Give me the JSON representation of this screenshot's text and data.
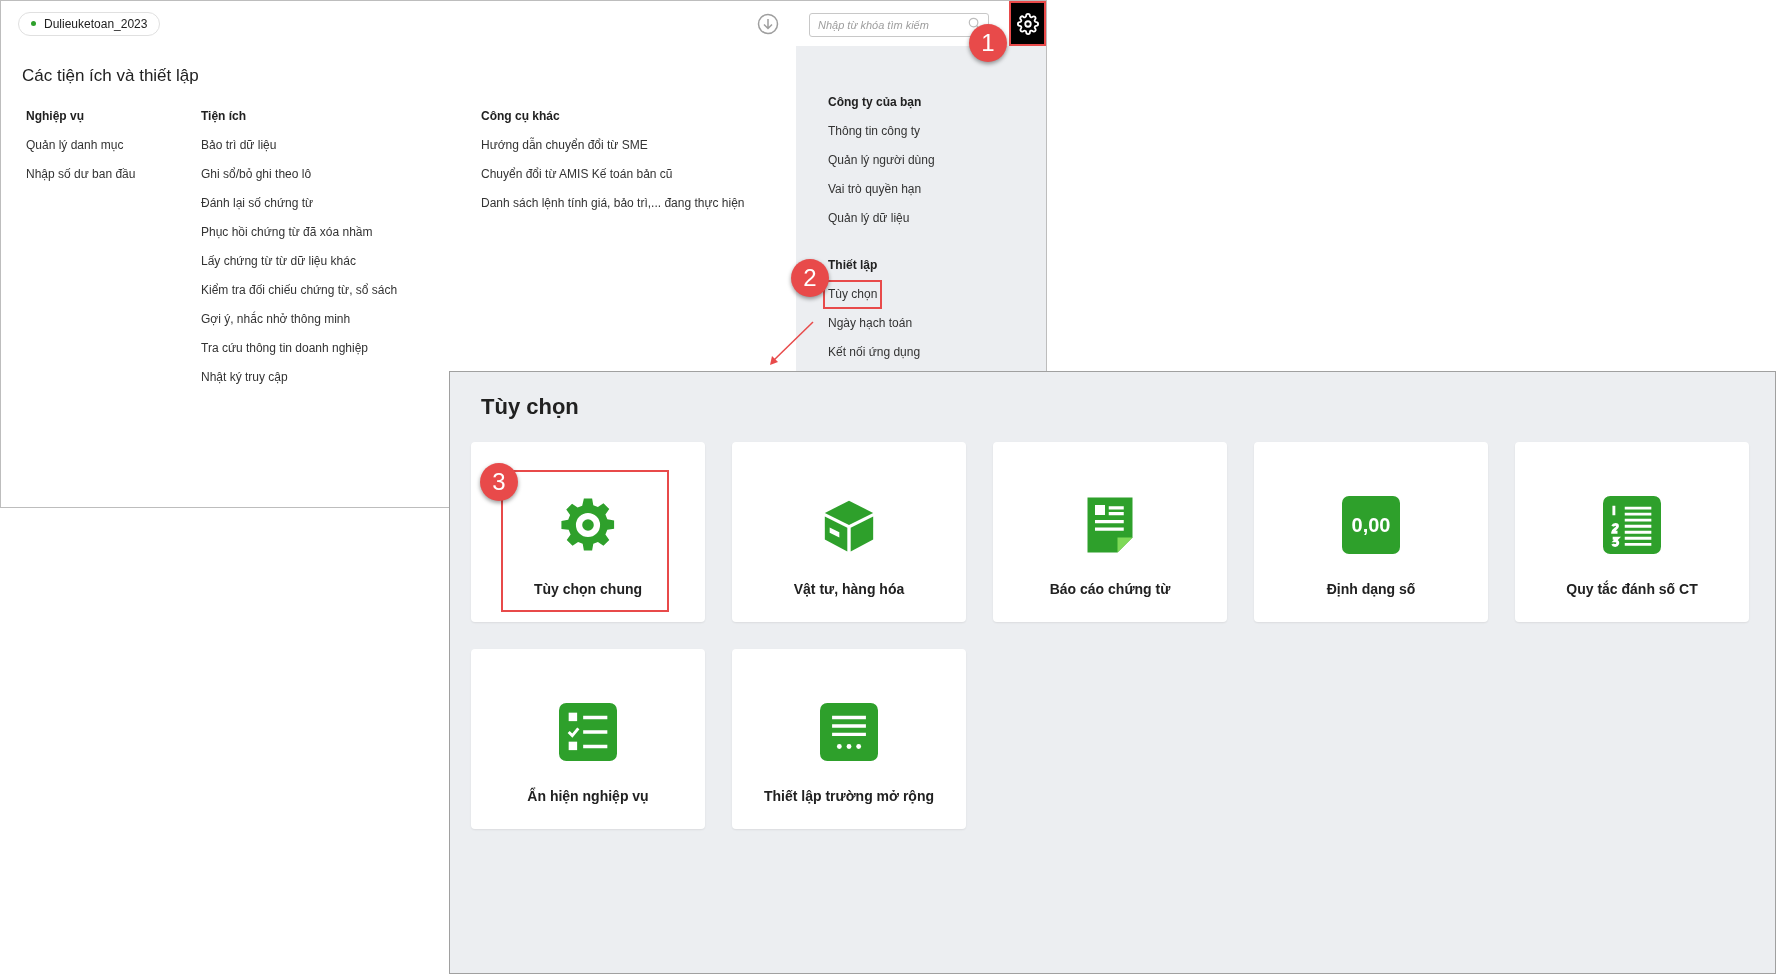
{
  "workspace_tag": {
    "label": "Dulieuketoan_2023"
  },
  "search": {
    "placeholder": "Nhập từ khóa tìm kiếm"
  },
  "settings_button": {
    "highlighted": true,
    "callout": "1"
  },
  "utilities": {
    "title": "Các tiện ích và thiết lập",
    "columns": [
      {
        "heading": "Nghiệp vụ",
        "items": [
          "Quản lý danh mục",
          "Nhập số dư ban đầu"
        ]
      },
      {
        "heading": "Tiện ích",
        "items": [
          "Bảo trì dữ liệu",
          "Ghi sổ/bỏ ghi theo lô",
          "Đánh lại số chứng từ",
          "Phục hồi chứng từ đã xóa nhầm",
          "Lấy chứng từ từ dữ liệu khác",
          "Kiểm tra đối chiếu chứng từ, sổ sách",
          "Gợi ý, nhắc nhở thông minh",
          "Tra cứu thông tin doanh nghiệp",
          "Nhật ký truy cập"
        ]
      },
      {
        "heading": "Công cụ khác",
        "items": [
          "Hướng dẫn chuyển đổi từ SME",
          "Chuyển đổi từ AMIS Kế toán bản cũ",
          "Danh sách lệnh tính giá, bảo trì,... đang thực hiện"
        ]
      }
    ]
  },
  "settings_menu": {
    "sections": [
      {
        "heading": "Công ty của bạn",
        "items": [
          {
            "label": "Thông tin công ty",
            "highlighted": false
          },
          {
            "label": "Quản lý người dùng",
            "highlighted": false
          },
          {
            "label": "Vai trò quyền hạn",
            "highlighted": false
          },
          {
            "label": "Quản lý dữ liệu",
            "highlighted": false
          }
        ]
      },
      {
        "heading": "Thiết lập",
        "items": [
          {
            "label": "Tùy chọn",
            "highlighted": true,
            "callout": "2"
          },
          {
            "label": "Ngày hạch toán",
            "highlighted": false
          },
          {
            "label": "Kết nối ứng dụng",
            "highlighted": false
          }
        ]
      }
    ]
  },
  "options_dialog": {
    "title": "Tùy chọn",
    "cards": [
      {
        "label": "Tùy chọn chung",
        "kind": "gear",
        "highlighted": true,
        "callout": "3"
      },
      {
        "label": "Vật tư, hàng hóa",
        "kind": "box",
        "highlighted": false
      },
      {
        "label": "Báo cáo chứng từ",
        "kind": "document",
        "highlighted": false
      },
      {
        "label": "Định dạng số",
        "kind": "number",
        "icon_text": "0,00",
        "highlighted": false
      },
      {
        "label": "Quy tắc đánh số CT",
        "kind": "numbered-list",
        "highlighted": false
      },
      {
        "label": "Ẩn hiện nghiệp vụ",
        "kind": "checklist",
        "highlighted": false
      },
      {
        "label": "Thiết lập trường mở rộng",
        "kind": "lines",
        "highlighted": false
      }
    ]
  }
}
